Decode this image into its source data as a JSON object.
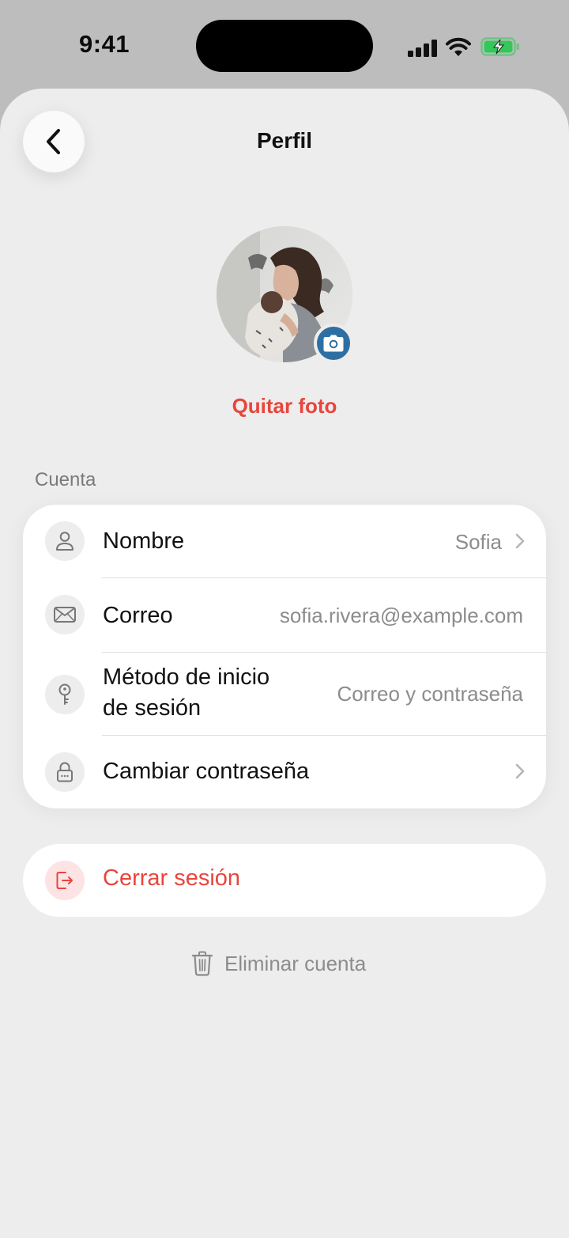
{
  "status_bar": {
    "time": "9:41",
    "battery_color": "#34c759"
  },
  "header": {
    "title": "Perfil"
  },
  "profile": {
    "remove_photo_label": "Quitar foto",
    "accent_color": "#e8453c",
    "camera_badge_color": "#2d6fa3"
  },
  "account": {
    "section_label": "Cuenta",
    "rows": [
      {
        "icon": "person-icon",
        "label": "Nombre",
        "value": "Sofia",
        "has_chevron": true
      },
      {
        "icon": "envelope-icon",
        "label": "Correo",
        "value": "sofia.rivera@example.com",
        "has_chevron": false
      },
      {
        "icon": "key-icon",
        "label_line1": "Método de inicio",
        "label_line2": "de sesión",
        "value": "Correo y contraseña",
        "has_chevron": false
      },
      {
        "icon": "lock-icon",
        "label": "Cambiar contraseña",
        "value": "",
        "has_chevron": true
      }
    ]
  },
  "actions": {
    "logout_label": "Cerrar sesión",
    "delete_label": "Eliminar cuenta"
  }
}
